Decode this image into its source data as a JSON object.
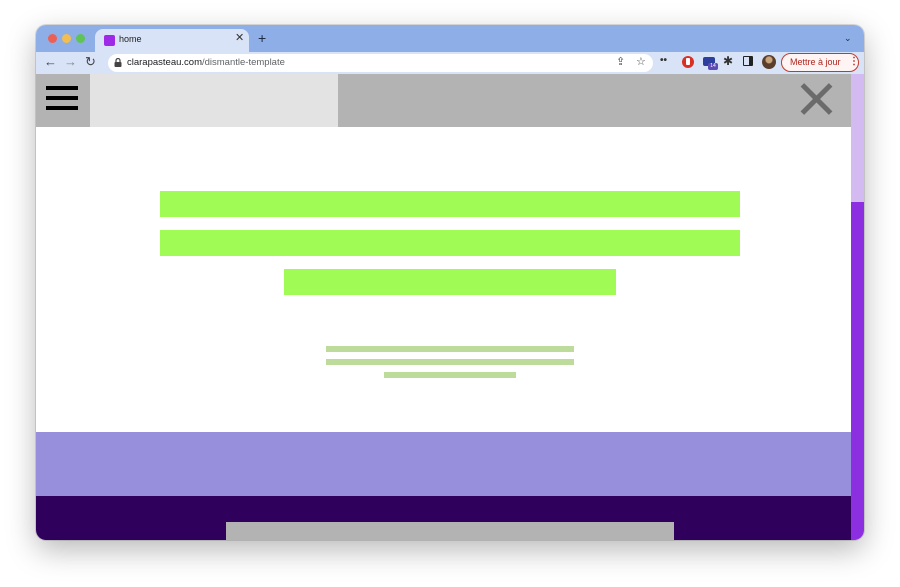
{
  "browser": {
    "tab": {
      "title": "home",
      "favicon_color": "#9e2ae8"
    },
    "url": {
      "host": "clarapasteau.com",
      "path": "/dismantle-template"
    },
    "update_button_label": "Mettre à jour",
    "extension_badge": "14",
    "icons": {
      "back": "arrow-left-icon",
      "forward": "arrow-right-icon",
      "reload": "reload-icon",
      "lock": "lock-icon",
      "share": "share-icon",
      "bookmark": "star-icon",
      "extensions": "puzzle-icon",
      "side_panel": "side-panel-icon",
      "menu": "kebab-menu-icon"
    }
  },
  "page": {
    "colors": {
      "header": "#b3b3b3",
      "header_panel": "#e3e3e3",
      "hero": "#a0fc54",
      "subtext": "#bddb9b",
      "lavender": "#978fdc",
      "dark": "#2f005c",
      "scrollbar_thumb": "#8c2fe0",
      "scrollbar_track": "#d3baf0"
    },
    "icons": {
      "menu": "hamburger-icon",
      "close": "close-icon"
    }
  }
}
